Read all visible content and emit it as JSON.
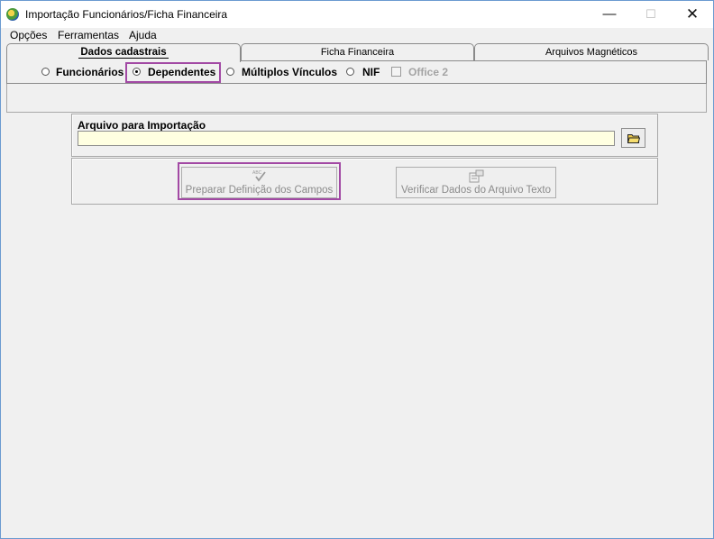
{
  "window": {
    "title": "Importação Funcionários/Ficha Financeira",
    "controls": {
      "minimize": "—",
      "maximize": "☐",
      "close": "✕"
    }
  },
  "menu": [
    "Opções",
    "Ferramentas",
    "Ajuda"
  ],
  "tabs": [
    {
      "label": "Dados cadastrais",
      "active": true
    },
    {
      "label": "Ficha Financeira",
      "active": false
    },
    {
      "label": "Arquivos Magnéticos",
      "active": false
    }
  ],
  "radio_options": [
    {
      "label": "Funcionários",
      "checked": false
    },
    {
      "label": "Dependentes",
      "checked": true
    },
    {
      "label": "Múltiplos Vínculos",
      "checked": false
    },
    {
      "label": "NIF",
      "checked": false
    }
  ],
  "checkbox": {
    "label": "Office 2",
    "checked": false,
    "enabled": false
  },
  "import": {
    "label": "Arquivo para Importação",
    "value": "",
    "browse_icon": "folder-open-icon"
  },
  "actions": {
    "prepare_label": "Preparar Definição dos Campos",
    "prepare_icon": "spellcheck-icon",
    "verify_label": "Verificar Dados do Arquivo Texto",
    "verify_icon": "form-check-icon"
  },
  "colors": {
    "highlight": "#a249a4",
    "input_background": "#ffffe1",
    "window_border": "#6b9ad0"
  }
}
